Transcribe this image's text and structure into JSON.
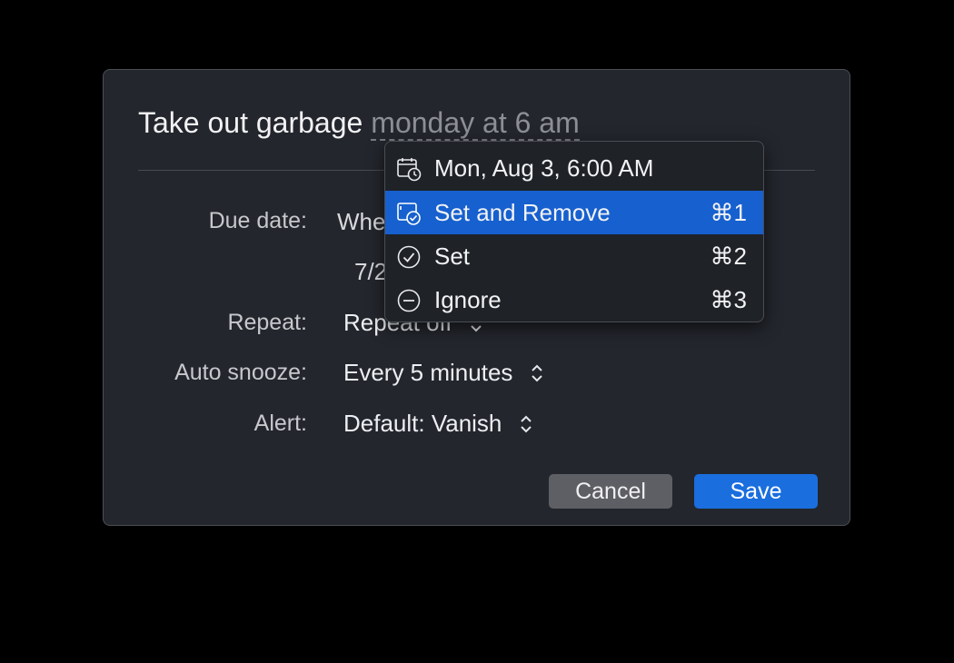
{
  "dialog": {
    "title": "Take out garbage",
    "title_date": "monday at 6 am",
    "rows": {
      "due_date": {
        "label": "Due date:",
        "value": "Whe",
        "sub_value": "7/2"
      },
      "repeat": {
        "label": "Repeat:",
        "value": "Repeat off"
      },
      "auto_snooze": {
        "label": "Auto snooze:",
        "value": "Every 5 minutes"
      },
      "alert": {
        "label": "Alert:",
        "value": "Default: Vanish"
      }
    },
    "buttons": {
      "cancel": "Cancel",
      "save": "Save"
    }
  },
  "menu": {
    "header": {
      "label": "Mon, Aug 3, 6:00 AM",
      "icon": "calendar-clock-icon"
    },
    "items": [
      {
        "label": "Set and Remove",
        "shortcut": "⌘1",
        "icon": "calendar-check-icon",
        "selected": true
      },
      {
        "label": "Set",
        "shortcut": "⌘2",
        "icon": "check-circle-icon",
        "selected": false
      },
      {
        "label": "Ignore",
        "shortcut": "⌘3",
        "icon": "minus-circle-icon",
        "selected": false
      }
    ]
  },
  "colors": {
    "background": "#000000",
    "dialog_bg": "#23262d",
    "menu_highlight": "#1760cf",
    "save_button": "#1a6ede",
    "cancel_button": "#5d5f64"
  }
}
